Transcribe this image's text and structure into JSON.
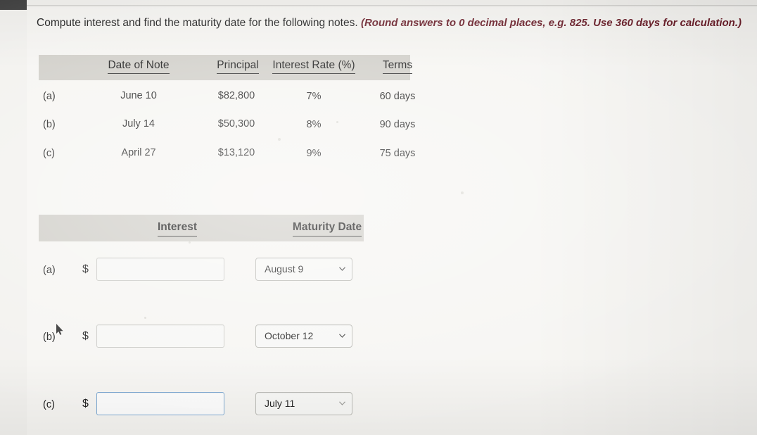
{
  "prompt": {
    "main": "Compute interest and find the maturity date for the following notes.",
    "hint": "(Round answers to 0 decimal places, e.g. 825. Use 360 days for calculation.)"
  },
  "notes_table": {
    "headers": {
      "label": "",
      "date_of_note": "Date of Note",
      "principal": "Principal",
      "interest_rate": "Interest Rate (%)",
      "terms": "Terms"
    },
    "rows": [
      {
        "label": "(a)",
        "date_of_note": "June 10",
        "principal": "$82,800",
        "interest_rate": "7%",
        "terms": "60 days"
      },
      {
        "label": "(b)",
        "date_of_note": "July 14",
        "principal": "$50,300",
        "interest_rate": "8%",
        "terms": "90 days"
      },
      {
        "label": "(c)",
        "date_of_note": "April 27",
        "principal": "$13,120",
        "interest_rate": "9%",
        "terms": "75 days"
      }
    ]
  },
  "answers_table": {
    "headers": {
      "interest": "Interest",
      "maturity_date": "Maturity Date"
    },
    "rows": [
      {
        "label": "(a)",
        "currency_symbol": "$",
        "interest_value": "",
        "interest_placeholder": "",
        "maturity_date": "August 9"
      },
      {
        "label": "(b)",
        "currency_symbol": "$",
        "interest_value": "",
        "interest_placeholder": "",
        "maturity_date": "October 12"
      },
      {
        "label": "(c)",
        "currency_symbol": "$",
        "interest_value": "",
        "interest_placeholder": "",
        "maturity_date": "July 11"
      }
    ]
  },
  "icons": {
    "caret": "chevron-down-icon",
    "cursor": "mouse-pointer-icon"
  },
  "colors": {
    "hint_text": "#6b1f2a",
    "header_band": "#cfcdc7",
    "page_background": "#f2f1ee",
    "focus_border": "#7aa7d2"
  }
}
